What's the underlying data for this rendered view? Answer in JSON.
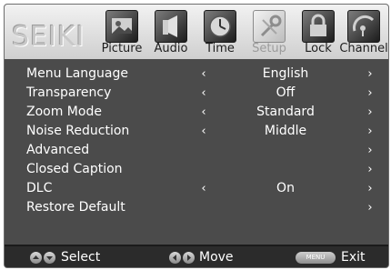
{
  "brand": "SEIKI",
  "tabs": [
    {
      "label": "Picture",
      "icon": "picture-icon",
      "active": false
    },
    {
      "label": "Audio",
      "icon": "audio-icon",
      "active": false
    },
    {
      "label": "Time",
      "icon": "clock-icon",
      "active": false
    },
    {
      "label": "Setup",
      "icon": "setup-icon",
      "active": true
    },
    {
      "label": "Lock",
      "icon": "lock-icon",
      "active": false
    },
    {
      "label": "Channel",
      "icon": "channel-icon",
      "active": false
    }
  ],
  "menu": [
    {
      "label": "Menu Language",
      "value": "English",
      "left_arrow": "‹",
      "right_arrow": "›"
    },
    {
      "label": "Transparency",
      "value": "Off",
      "left_arrow": "‹",
      "right_arrow": "›"
    },
    {
      "label": "Zoom Mode",
      "value": "Standard",
      "left_arrow": "‹",
      "right_arrow": "›"
    },
    {
      "label": "Noise Reduction",
      "value": "Middle",
      "left_arrow": "‹",
      "right_arrow": "›"
    },
    {
      "label": "Advanced",
      "value": "",
      "left_arrow": "",
      "right_arrow": "›"
    },
    {
      "label": "Closed Caption",
      "value": "",
      "left_arrow": "",
      "right_arrow": "›"
    },
    {
      "label": "DLC",
      "value": "On",
      "left_arrow": "‹",
      "right_arrow": "›"
    },
    {
      "label": "Restore Default",
      "value": "",
      "left_arrow": "",
      "right_arrow": "›"
    }
  ],
  "footer": {
    "select_label": "Select",
    "move_label": "Move",
    "menu_button": "MENU",
    "exit_label": "Exit"
  },
  "colors": {
    "background": "#4b4b4b",
    "header": "#dedede",
    "footer": "#2b2b2b",
    "text": "#ffffff"
  }
}
